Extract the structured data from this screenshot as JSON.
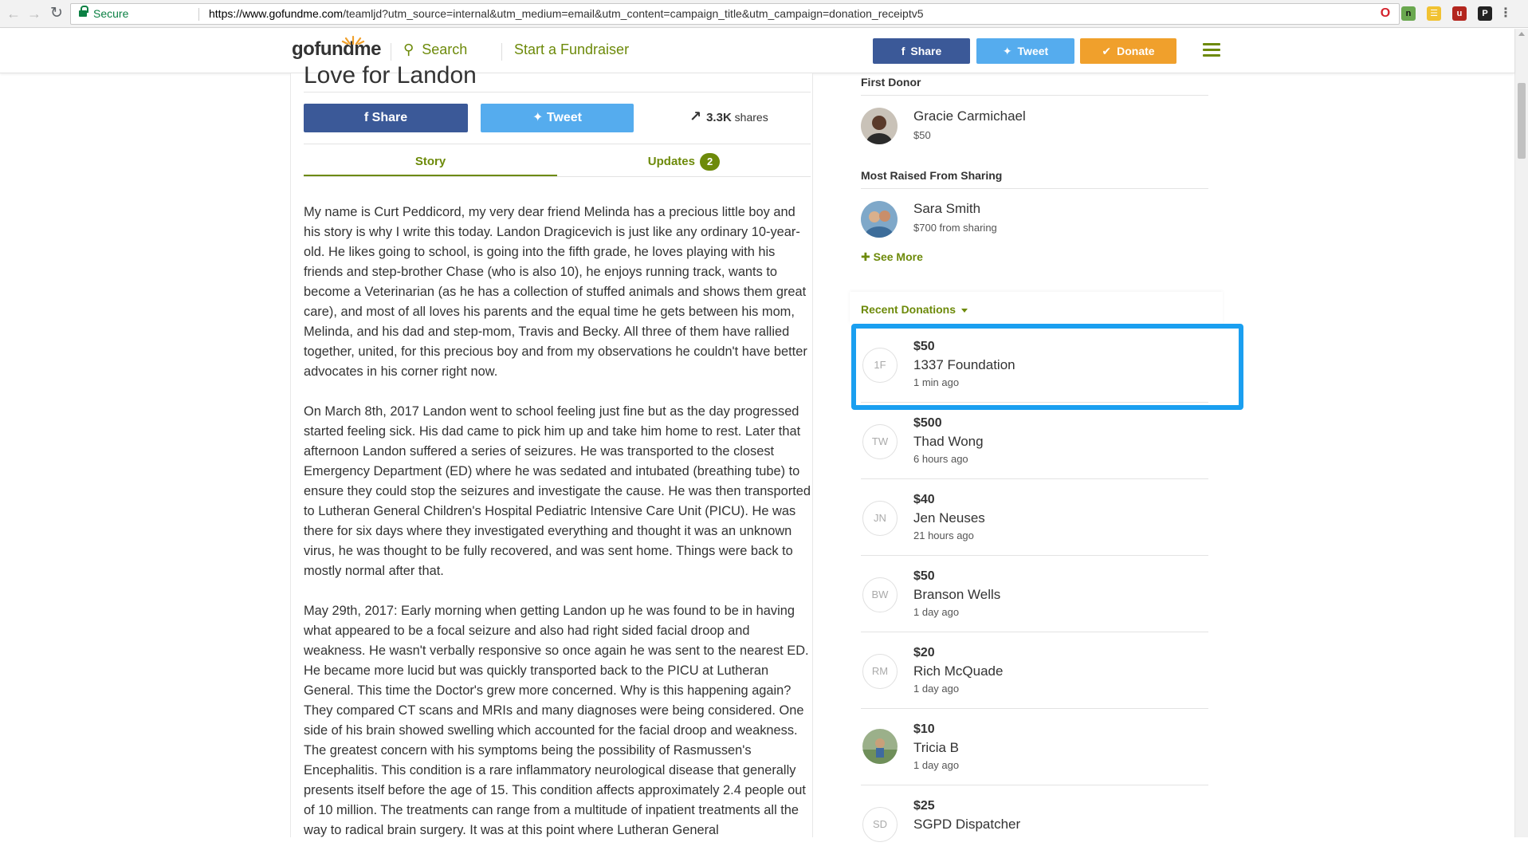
{
  "browser": {
    "secure_label": "Secure",
    "url_host": "https://www.gofundme.com",
    "url_path": "/teamljd?utm_source=internal&utm_medium=email&utm_content=campaign_title&utm_campaign=donation_receiptv5"
  },
  "header": {
    "logo": "gofundme",
    "search_label": "Search",
    "start_label": "Start a Fundraiser",
    "share_label": "Share",
    "tweet_label": "Tweet",
    "donate_label": "Donate"
  },
  "campaign": {
    "title": "Love for Landon",
    "share_label": "Share",
    "tweet_label": "Tweet",
    "shares_count": "3.3K",
    "shares_suffix": "shares",
    "tab_story": "Story",
    "tab_updates": "Updates",
    "updates_count": "2",
    "story_paragraphs": [
      "My name is Curt Peddicord, my very dear friend Melinda has a precious little boy and his story is why I write this today. Landon Dragicevich is just like any ordinary 10-year-old. He likes going to school, is going into the fifth grade, he loves playing with his friends and step-brother Chase (who is also 10), he enjoys running track, wants to become a Veterinarian (as he has a collection of stuffed animals and shows them great care), and most of all loves his parents and the equal time he gets between his mom, Melinda, and his dad and step-mom, Travis and Becky. All three of them have rallied together, united, for this precious boy and from my observations he couldn't have better advocates in his corner right now.",
      "On March 8th, 2017 Landon went to school feeling just fine but as the day progressed started feeling sick. His dad came to pick him up and take him home to rest. Later that afternoon Landon suffered a series of seizures. He was transported to the closest Emergency Department (ED) where he was sedated and intubated (breathing tube) to ensure they could stop the seizures and investigate the cause. He was then transported to Lutheran General Children's Hospital Pediatric Intensive Care Unit (PICU). He was there for six days where they investigated everything and thought it was an unknown virus, he was thought to be fully recovered, and was sent home. Things were back to mostly normal after that.",
      "May 29th, 2017: Early morning when getting Landon up he was found to be in having what appeared to be a focal seizure and also had right sided facial droop and weakness. He wasn't verbally responsive so once again he was sent to the nearest ED. He became more lucid but was quickly transported back to the PICU at Lutheran General. This time the Doctor's grew more concerned. Why is this happening again? They compared CT scans and MRIs and many diagnoses were being considered. One side of his brain showed swelling which accounted for the facial droop and weakness. The greatest concern with his symptoms being the possibility of Rasmussen's Encephalitis. This condition is a rare inflammatory neurological disease that generally presents itself before the age of 15. This condition affects approximately 2.4 people out of 10 million. The treatments can range from a multitude of inpatient treatments all the way to radical brain surgery. It was at this point where Lutheran General"
    ]
  },
  "sidebar": {
    "first_donor_label": "First Donor",
    "first_donor": {
      "name": "Gracie Carmichael",
      "amount": "$50"
    },
    "most_raised_label": "Most Raised From Sharing",
    "most_raised": {
      "name": "Sara Smith",
      "amount": "$700 from sharing"
    },
    "see_more_label": "See More",
    "recent_label": "Recent Donations",
    "donations": [
      {
        "initials": "1F",
        "amount": "$50",
        "name": "1337 Foundation",
        "time": "1 min ago"
      },
      {
        "initials": "TW",
        "amount": "$500",
        "name": "Thad Wong",
        "time": "6 hours ago"
      },
      {
        "initials": "JN",
        "amount": "$40",
        "name": "Jen Neuses",
        "time": "21 hours ago"
      },
      {
        "initials": "BW",
        "amount": "$50",
        "name": "Branson Wells",
        "time": "1 day ago"
      },
      {
        "initials": "RM",
        "amount": "$20",
        "name": "Rich McQuade",
        "time": "1 day ago"
      },
      {
        "initials": "",
        "amount": "$10",
        "name": "Tricia B",
        "time": "1 day ago"
      },
      {
        "initials": "SD",
        "amount": "$25",
        "name": "SGPD Dispatcher",
        "time": ""
      }
    ]
  },
  "colors": {
    "brand_green": "#6d8a0a",
    "facebook_blue": "#3b5998",
    "twitter_blue": "#55acee",
    "donate_orange": "#f0a02c",
    "highlight_blue": "#1a9ff0"
  },
  "icons": [
    "back-icon",
    "forward-icon",
    "reload-icon",
    "lock-icon",
    "star-icon",
    "search-icon",
    "facebook-icon",
    "twitter-icon",
    "check-icon",
    "menu-icon",
    "trending-icon",
    "plus-icon",
    "caret-down-icon"
  ]
}
